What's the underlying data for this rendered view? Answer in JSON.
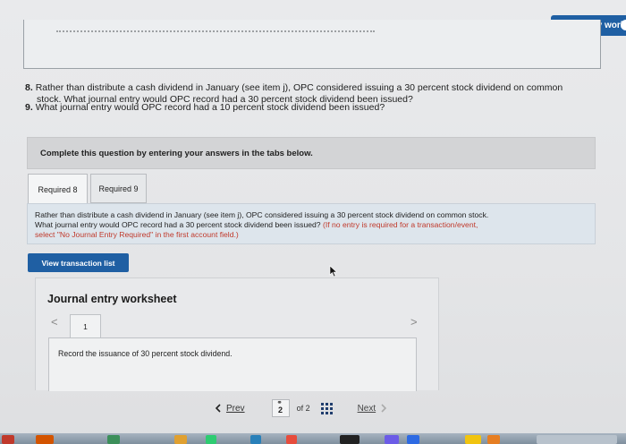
{
  "header": {
    "check_button_label": "Check my work"
  },
  "questions": {
    "q8_num": "8.",
    "q8_line1": "Rather than distribute a cash dividend in January (see item j), OPC considered issuing a 30 percent stock dividend on common",
    "q8_line2": "stock. What journal entry would OPC record had a 30 percent stock dividend been issued?",
    "q9_num": "9.",
    "q9_text": "What journal entry would OPC record had a 10 percent stock dividend been issued?"
  },
  "complete_banner": "Complete this question by entering your answers in the tabs below.",
  "tabs": [
    {
      "label": "Required 8",
      "active": true
    },
    {
      "label": "Required 9",
      "active": false
    }
  ],
  "instruction": {
    "line1": "Rather than distribute a cash dividend in January (see item j), OPC considered issuing a 30 percent stock dividend on common stock.",
    "line2a": "What journal entry would OPC record had a 30 percent stock dividend been issued?",
    "line2b": "(If no entry is required for a transaction/event,",
    "line3": "select \"No Journal Entry Required\" in the first account field.)"
  },
  "view_transaction_button": "View transaction list",
  "worksheet": {
    "title": "Journal entry worksheet",
    "prev_arrow": "<",
    "next_arrow": ">",
    "tab_label": "1",
    "record_text": "Record the issuance of 30 percent stock dividend."
  },
  "pager": {
    "prev_label": "Prev",
    "current_page": "2",
    "of_label": "of 2",
    "next_label": "Next"
  },
  "colors": {
    "accent": "#1f5fa3",
    "instruction_bg": "#dde5ec",
    "banner_bg": "#d3d4d6",
    "warning_text": "#c0392b"
  }
}
